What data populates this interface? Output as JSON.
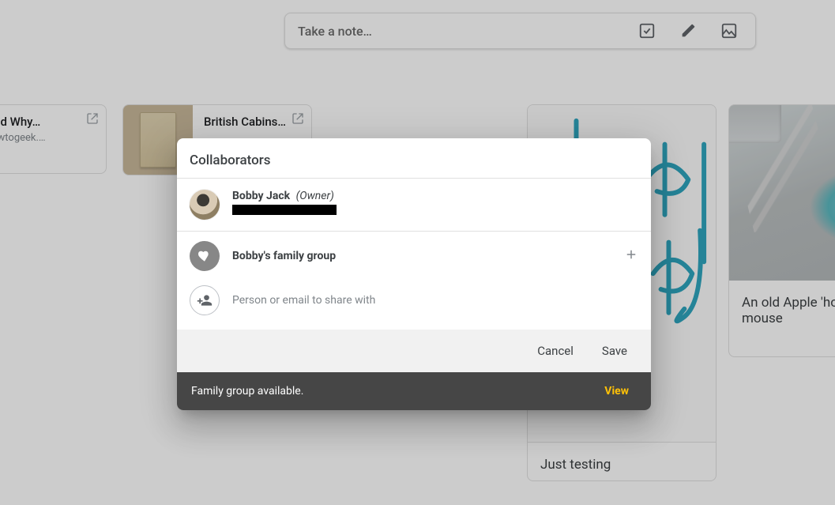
{
  "note_input": {
    "placeholder": "Take a note…"
  },
  "cards": {
    "a": {
      "title": "How and Why…",
      "subtitle": "www.howtogeek.…"
    },
    "b": {
      "title": "British Cabins…"
    },
    "c": {
      "caption": "Just testing"
    },
    "d": {
      "caption": "An old Apple 'hockey puck' mouse"
    }
  },
  "modal": {
    "title": "Collaborators",
    "owner": {
      "name": "Bobby Jack",
      "role": "(Owner)"
    },
    "group": {
      "name": "Bobby's family group"
    },
    "share_input_placeholder": "Person or email to share with",
    "cancel": "Cancel",
    "save": "Save",
    "toast_text": "Family group available.",
    "toast_action": "View"
  }
}
